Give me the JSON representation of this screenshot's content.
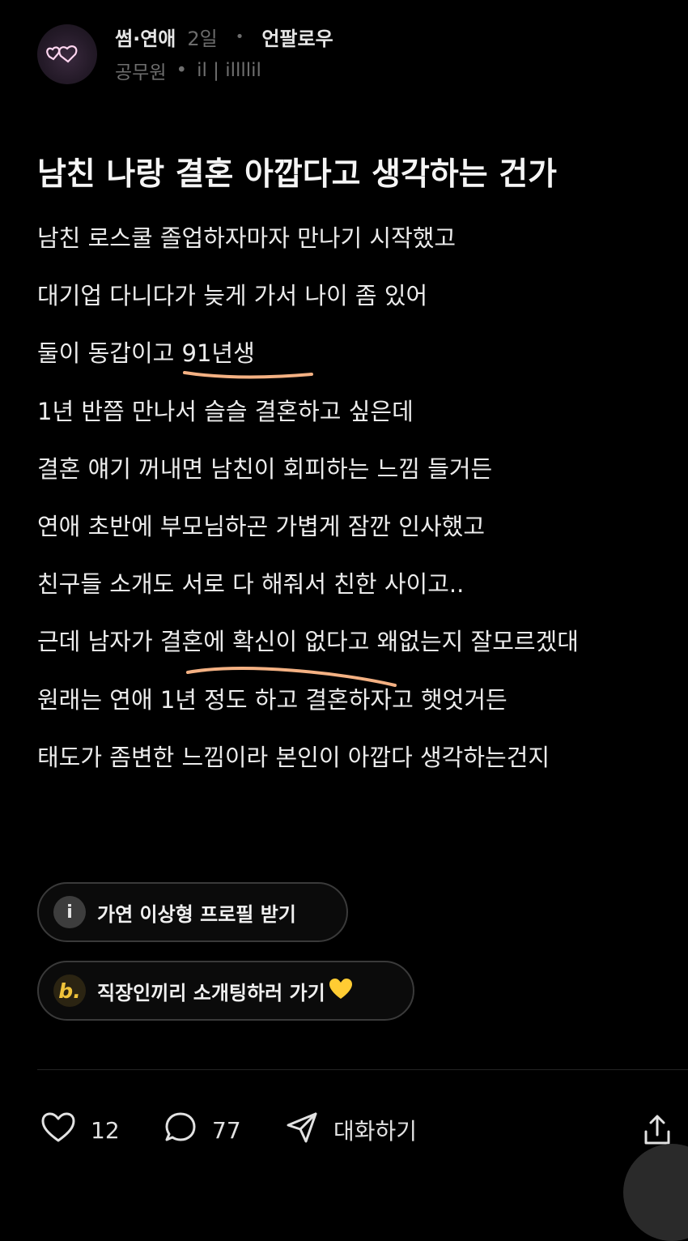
{
  "post": {
    "category": "썸·연애",
    "time": "2일",
    "separator": "•",
    "follow_label": "언팔로우",
    "author_job": "공무원",
    "author_separator": "•",
    "author_name": "il | illllil",
    "title": "남친 나랑 결혼 아깝다고 생각하는 건가",
    "body_lines": [
      "남친 로스쿨 졸업하자마자 만나기 시작했고",
      "대기업 다니다가 늦게 가서 나이 좀 있어",
      "둘이 동갑이고 91년생",
      "1년 반쯤 만나서 슬슬 결혼하고 싶은데",
      "결혼 얘기 꺼내면 남친이 회피하는 느낌 들거든",
      "연애 초반에 부모님하곤 가볍게 잠깐 인사했고",
      "친구들 소개도 서로 다 해줘서 친한 사이고..",
      "근데 남자가 결혼에 확신이 없다고 왜없는지 잘모르겠대",
      "원래는 연애 1년 정도 하고 결혼하자고 햇엇거든",
      "태도가 좀변한 느낌이라 본인이 아깝다 생각하는건지"
    ]
  },
  "chips": [
    {
      "icon": "i",
      "label": "가연 이상형 프로필 받기"
    },
    {
      "icon": "b.",
      "label": "직장인끼리 소개팅하러 가기"
    }
  ],
  "actions": {
    "likes": "12",
    "comments": "77",
    "dm_label": "대화하기"
  },
  "colors": {
    "background": "#000000",
    "underline": "#f4b183",
    "chip_border": "#3a3a3a"
  }
}
